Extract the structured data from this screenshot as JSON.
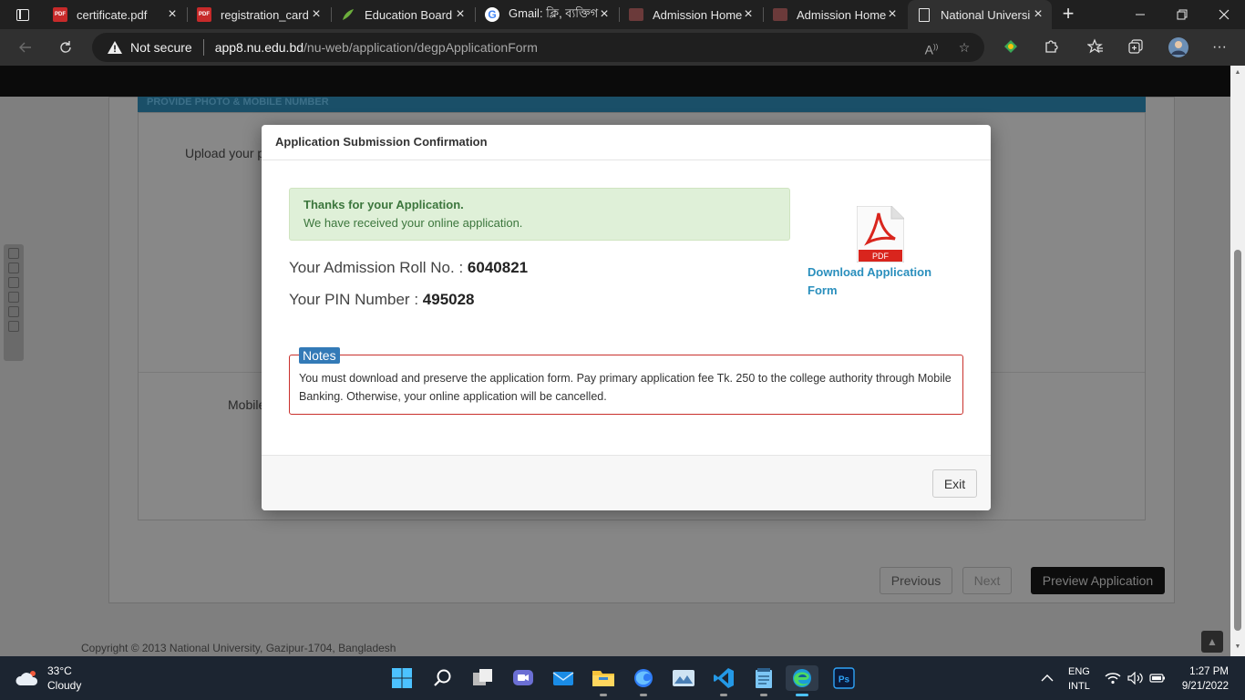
{
  "browser": {
    "tabs": [
      {
        "title": "certificate.pdf",
        "icon": "pdf-icon"
      },
      {
        "title": "registration_card",
        "icon": "pdf-icon"
      },
      {
        "title": "Education Board",
        "icon": "leaf-icon"
      },
      {
        "title": "Gmail: ক্লি, ব্যক্তিগ",
        "icon": "google-icon"
      },
      {
        "title": "Admission Home",
        "icon": "admission-icon"
      },
      {
        "title": "Admission Home",
        "icon": "admission-icon"
      },
      {
        "title": "National Universi",
        "icon": "page-icon"
      }
    ],
    "security_label": "Not secure",
    "url_host": "app8.nu.edu.bd",
    "url_path": "/nu-web/application/degpApplicationForm"
  },
  "page": {
    "section_header": "PROVIDE PHOTO & MOBILE NUMBER",
    "upload_label": "Upload your p",
    "mobile_label": "Mobile",
    "previous_label": "Previous",
    "next_label": "Next",
    "preview_label": "Preview Application",
    "copyright": "Copyright © 2013 National University, Gazipur-1704, Bangladesh"
  },
  "modal": {
    "title": "Application Submission Confirmation",
    "alert_title": "Thanks for your Application.",
    "alert_text": "We have received your online application.",
    "roll_label": "Your Admission Roll No. : ",
    "roll_value": "6040821",
    "pin_label": "Your PIN Number : ",
    "pin_value": "495028",
    "download_label": "Download Application Form",
    "pdf_badge": "PDF",
    "notes_title": "Notes",
    "notes_text": "You must download and preserve the application form. Pay primary application fee Tk. 250 to the college authority through Mobile Banking. Otherwise, your online application will be cancelled.",
    "exit_label": "Exit"
  },
  "taskbar": {
    "temperature": "33°C",
    "weather": "Cloudy",
    "lang_top": "ENG",
    "lang_bottom": "INTL",
    "time": "1:27 PM",
    "date": "9/21/2022"
  },
  "colors": {
    "alert_bg": "#dff0d8",
    "alert_text": "#3c763d",
    "link": "#2a8fbd",
    "notes_border": "#c9302c",
    "notes_legend": "#337ab7"
  }
}
